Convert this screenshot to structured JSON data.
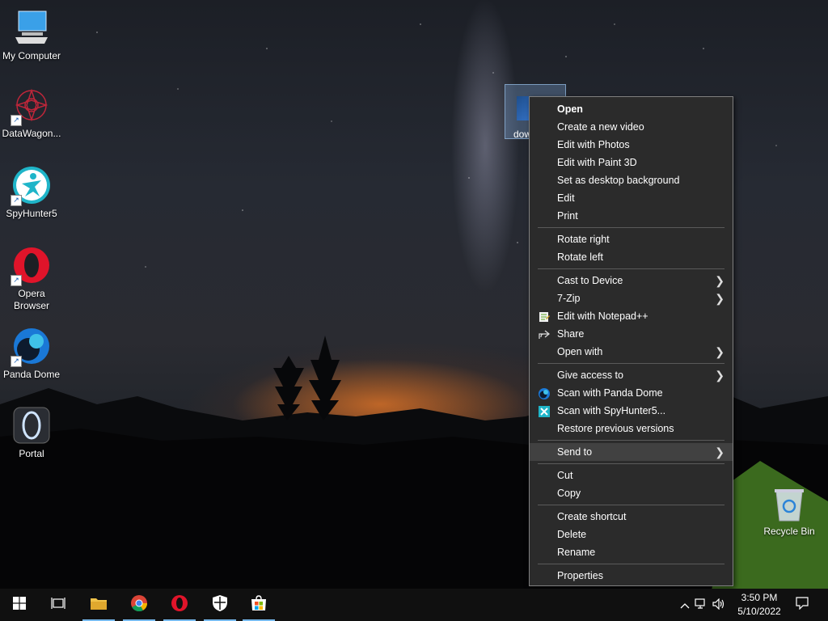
{
  "desktop": {
    "icons": [
      {
        "label": "My Computer"
      },
      {
        "label": "DataWagon..."
      },
      {
        "label": "SpyHunter5"
      },
      {
        "label": "Opera Browser"
      },
      {
        "label": "Panda Dome"
      },
      {
        "label": "Portal"
      }
    ],
    "selected_file": {
      "label": "dow"
    },
    "recycle_bin": {
      "label": "Recycle Bin"
    }
  },
  "context_menu": {
    "items": [
      {
        "label": "Open",
        "bold": true
      },
      {
        "label": "Create a new video"
      },
      {
        "label": "Edit with Photos"
      },
      {
        "label": "Edit with Paint 3D"
      },
      {
        "label": "Set as desktop background"
      },
      {
        "label": "Edit"
      },
      {
        "label": "Print"
      },
      {
        "label": "Rotate right"
      },
      {
        "label": "Rotate left"
      },
      {
        "label": "Cast to Device",
        "submenu": true
      },
      {
        "label": "7-Zip",
        "submenu": true
      },
      {
        "label": "Edit with Notepad++",
        "icon": "notepad-plus-plus-icon"
      },
      {
        "label": "Share",
        "icon": "share-icon"
      },
      {
        "label": "Open with",
        "submenu": true
      },
      {
        "label": "Give access to",
        "submenu": true
      },
      {
        "label": "Scan with Panda Dome",
        "icon": "panda-dome-icon"
      },
      {
        "label": "Scan with SpyHunter5...",
        "icon": "spyhunter-icon"
      },
      {
        "label": "Restore previous versions"
      },
      {
        "label": "Send to",
        "submenu": true,
        "highlighted": true
      },
      {
        "label": "Cut"
      },
      {
        "label": "Copy"
      },
      {
        "label": "Create shortcut"
      },
      {
        "label": "Delete"
      },
      {
        "label": "Rename"
      },
      {
        "label": "Properties"
      }
    ],
    "submenu_arrow": ">"
  },
  "taskbar": {
    "start_icon": "windows-start-icon",
    "apps": [
      "task-view-icon",
      "file-explorer-icon",
      "chrome-icon",
      "opera-icon",
      "security-shield-icon",
      "store-icon"
    ],
    "tray": {
      "time": "3:50 PM",
      "date": "5/10/2022"
    }
  },
  "colors": {
    "menu_bg": "#2b2b2b",
    "menu_highlight": "#414141",
    "taskbar_bg": "#101010",
    "active_indicator": "#76b9ed"
  }
}
